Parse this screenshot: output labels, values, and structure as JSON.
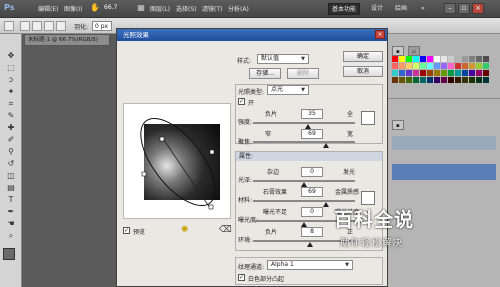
{
  "menubar": {
    "logo": "Ps",
    "items": [
      "编辑(E)",
      "图像(I)",
      "图层(L)",
      "选择(S)",
      "滤镜(T)",
      "分析(A)"
    ],
    "zoom": "66.7",
    "workspaces": [
      "基本功能",
      "设计",
      "绘画"
    ],
    "more": "»"
  },
  "optbar": {
    "feather_label": "羽化:",
    "feather_value": "0 px"
  },
  "doc_tab": "未标题-1 @ 66.7%(RGB/8)",
  "dialog": {
    "title": "光照效果",
    "style_label": "样式:",
    "style_value": "默认值",
    "ok": "确定",
    "cancel": "取消",
    "save": "存储...",
    "delete": "删除",
    "light_type_label": "光照类型:",
    "light_type_value": "点光",
    "on_label": "开",
    "intensity_label": "强度:",
    "intensity_left": "负片",
    "intensity_value": "35",
    "intensity_right": "全",
    "focus_label": "聚焦:",
    "focus_left": "窄",
    "focus_value": "69",
    "focus_right": "宽",
    "props_header": "属性:",
    "gloss_label": "光泽:",
    "gloss_left": "杂边",
    "gloss_value": "0",
    "gloss_right": "发光",
    "material_label": "材料:",
    "material_left": "石膏效果",
    "material_value": "69",
    "material_right": "金属质感",
    "exposure_label": "曝光度:",
    "exposure_left": "曝光不足",
    "exposure_value": "0",
    "exposure_right": "曝光过度",
    "ambience_label": "环境:",
    "ambience_left": "负片",
    "ambience_value": "8",
    "ambience_right": "正",
    "texture_label": "纹理通道:",
    "texture_value": "Alpha 1",
    "white_high_label": "白色部分凸起",
    "preview_label": "预览"
  },
  "watermark": {
    "title": "百科全说",
    "subtitle": "助你轻松解决"
  },
  "colors": {
    "accent": "#1f4f9f",
    "dialog_bg": "#e9e8e3",
    "swatches": [
      "#ff0000",
      "#ffff00",
      "#00ff00",
      "#00ffff",
      "#0000ff",
      "#ff00ff",
      "#ffffff",
      "#e6e6e6",
      "#cccccc",
      "#b3b3b3",
      "#999999",
      "#808080",
      "#666666",
      "#4d4d4d",
      "#ff6666",
      "#ff9966",
      "#ffcc66",
      "#ccff66",
      "#66ff99",
      "#66ffff",
      "#6699ff",
      "#9966ff",
      "#ff66cc",
      "#cc3333",
      "#cc6633",
      "#cc9933",
      "#99cc33",
      "#33cc66",
      "#33cccc",
      "#3366cc",
      "#6633cc",
      "#cc3399",
      "#990000",
      "#994400",
      "#997700",
      "#669900",
      "#009944",
      "#009999",
      "#004499",
      "#440099",
      "#990066",
      "#660000",
      "#663300",
      "#665500",
      "#446600",
      "#006633",
      "#006666",
      "#003366",
      "#330066",
      "#660044",
      "#330000",
      "#331a00",
      "#333300",
      "#1a3300",
      "#003319",
      "#003333"
    ]
  }
}
